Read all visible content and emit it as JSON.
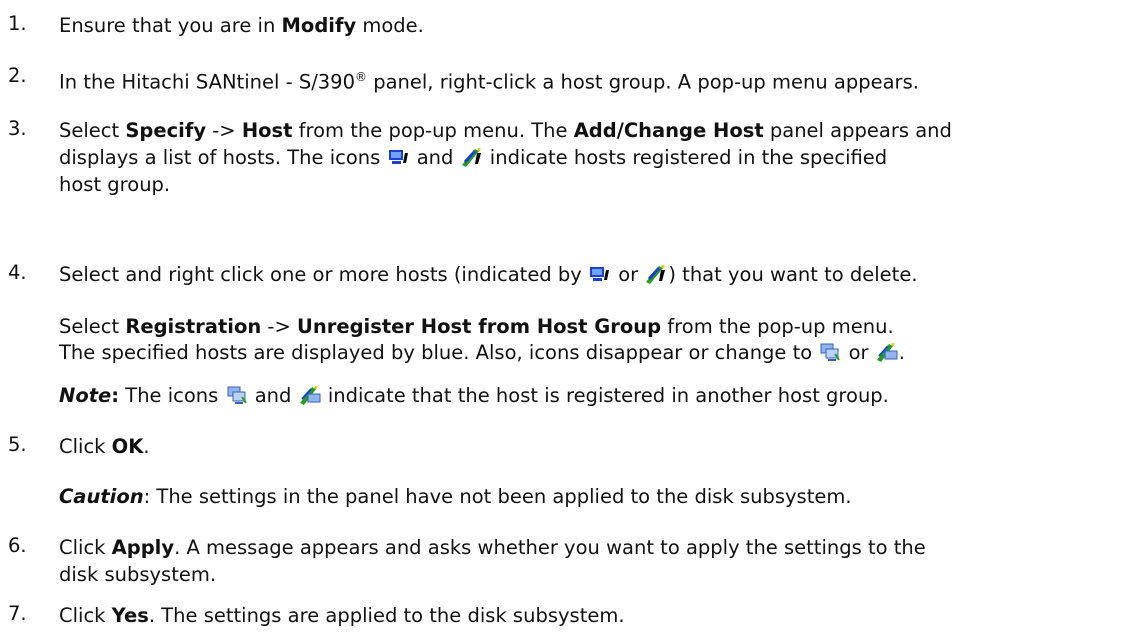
{
  "steps": [
    {
      "num": "1.",
      "a": "Ensure that you are in ",
      "b": "Modify",
      "c": " mode."
    },
    {
      "num": "2.",
      "a": "In the Hitachi SANtinel - S/390",
      "reg": "®",
      "b": " panel, right-click a host group. A pop-up menu appears."
    },
    {
      "num": "3.",
      "a": "Select ",
      "b1": "Specify",
      "a2": " -> ",
      "b2": "Host",
      "a3": " from the pop-up menu. The ",
      "b3": "Add/Change Host",
      "a4": " panel appears and",
      "line2": "displays a list of hosts. The icons",
      "and": " and ",
      "line2b": " indicate hosts registered in the specified",
      "line3": "host group."
    },
    {
      "num": "4.",
      "a": "Select and right click one or more hosts (indicated by ",
      "or": " or ",
      "b": ") that you want to delete.",
      "sub1a": "Select ",
      "sub1b": "Registration",
      "sub1c": " -> ",
      "sub1d": "Unregister Host from Host Group",
      "sub1e": " from the pop-up menu.",
      "sub2a": "The specified hosts are displayed by blue. Also, icons disappear or change to ",
      "sub2or": " or ",
      "sub2end": ".",
      "note_label": "Note",
      "note_colon": ":",
      "note_a": " The icons ",
      "note_and": " and ",
      "note_b": " indicate that the host is registered in another host group."
    },
    {
      "num": "5.",
      "a": "Click ",
      "b": "OK",
      "c": ".",
      "caution_label": "Caution",
      "caution_text": ": The settings in the panel have not been applied to the disk subsystem."
    },
    {
      "num": "6.",
      "a": "Click ",
      "b": "Apply",
      "c": ". A message appears and asks whether you want to apply the settings to the",
      "line2": "disk subsystem."
    },
    {
      "num": "7.",
      "a": "Click ",
      "b": "Yes",
      "c": ". The settings are applied to the disk subsystem."
    }
  ],
  "icons": [
    "host-registered-icon",
    "host-registered-alt-icon",
    "host-other-group-icon",
    "host-other-group-alt-icon"
  ]
}
